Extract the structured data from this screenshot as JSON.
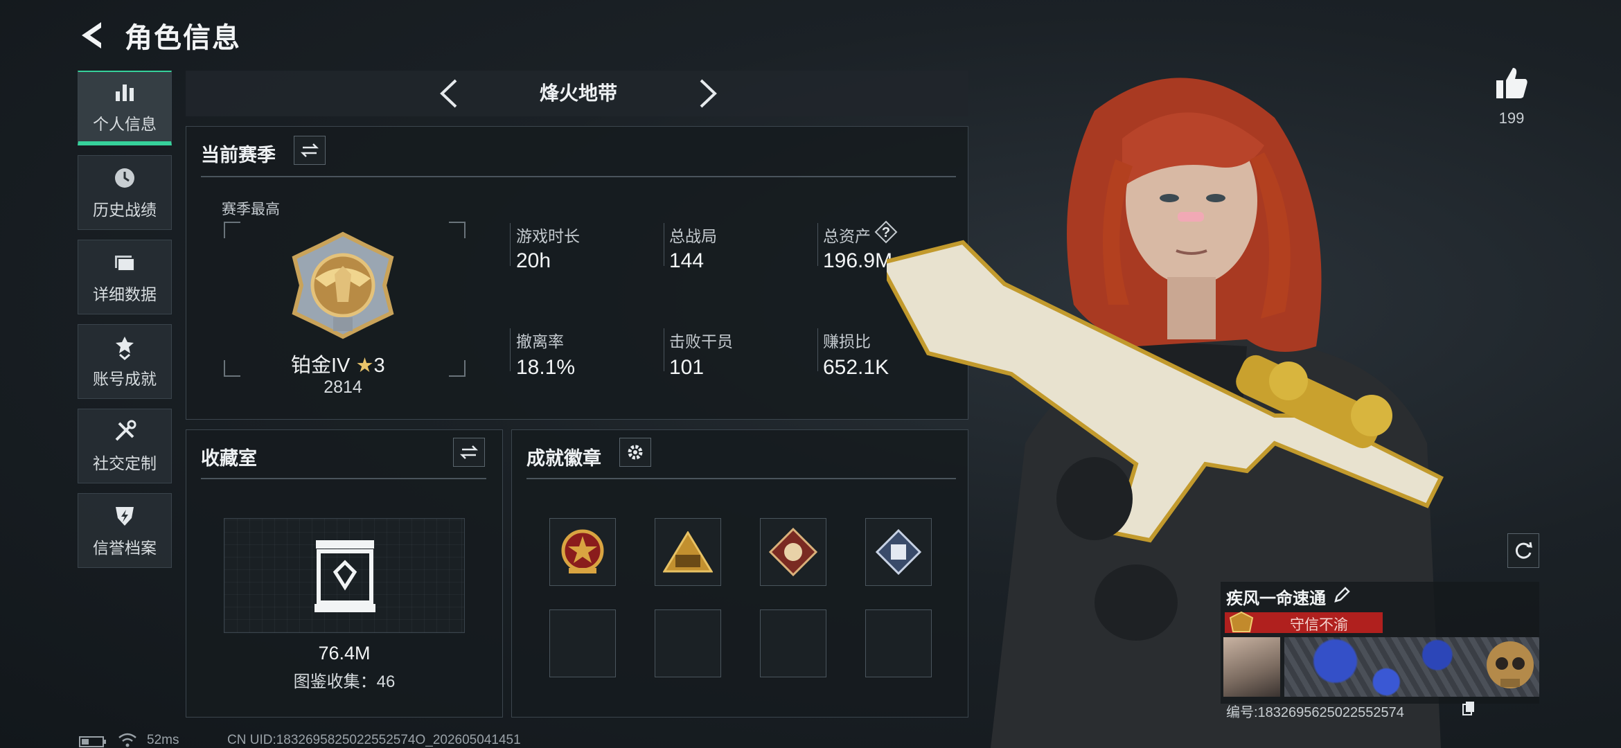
{
  "header": {
    "title": "角色信息"
  },
  "sidebar": {
    "items": [
      {
        "label": "个人信息",
        "icon": "bar-chart-icon",
        "active": true
      },
      {
        "label": "历史战绩",
        "icon": "clock-icon"
      },
      {
        "label": "详细数据",
        "icon": "folder-icon"
      },
      {
        "label": "账号成就",
        "icon": "achievement-icon"
      },
      {
        "label": "社交定制",
        "icon": "tools-icon"
      },
      {
        "label": "信誉档案",
        "icon": "shield-bolt-icon"
      }
    ]
  },
  "mode": {
    "title": "烽火地带"
  },
  "season": {
    "title": "当前赛季",
    "best_label": "赛季最高",
    "rank_name": "铂金IV",
    "rank_stars": "3",
    "rank_score": "2814",
    "stats": [
      {
        "label": "游戏时长",
        "value": "20h"
      },
      {
        "label": "总战局",
        "value": "144"
      },
      {
        "label": "总资产",
        "value": "196.9M"
      },
      {
        "label": "撤离率",
        "value": "18.1%"
      },
      {
        "label": "击败干员",
        "value": "101"
      },
      {
        "label": "赚损比",
        "value": "652.1K"
      }
    ]
  },
  "collection": {
    "title": "收藏室",
    "value": "76.4M",
    "catalog_label": "图鉴收集：46"
  },
  "achievements": {
    "title": "成就徽章"
  },
  "likes": {
    "count": "199"
  },
  "player_card": {
    "name": "疾风一命速通",
    "title_badge": "守信不渝",
    "id_line": "编号:1832695625022552574"
  },
  "status_bar": {
    "ping": "52ms",
    "uid": "CN UID:1832695825022552574O_202605041451"
  },
  "colors": {
    "accent": "#36d19b",
    "panel": "#161b1f",
    "title_red": "#b0201e"
  }
}
